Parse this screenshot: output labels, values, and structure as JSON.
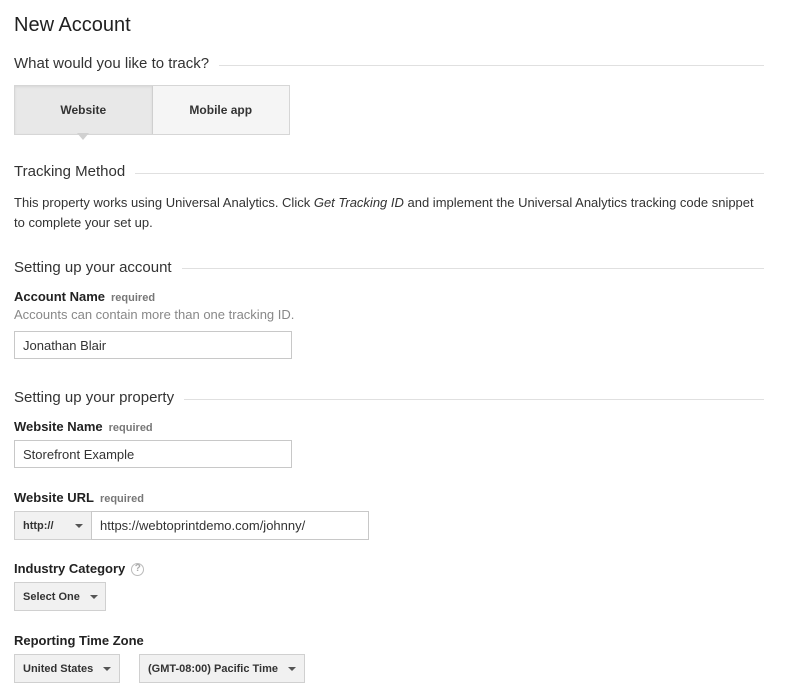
{
  "page": {
    "title": "New Account"
  },
  "track": {
    "heading": "What would you like to track?",
    "options": [
      "Website",
      "Mobile app"
    ],
    "selected": "Website"
  },
  "tracking_method": {
    "heading": "Tracking Method",
    "text_before": "This property works using Universal Analytics. Click ",
    "link_text": "Get Tracking ID",
    "text_after": " and implement the Universal Analytics tracking code snippet to complete your set up."
  },
  "account": {
    "heading": "Setting up your account",
    "name_label": "Account Name",
    "required": "required",
    "hint": "Accounts can contain more than one tracking ID.",
    "name_value": "Jonathan Blair"
  },
  "property": {
    "heading": "Setting up your property",
    "website_name_label": "Website Name",
    "website_name_value": "Storefront Example",
    "website_url_label": "Website URL",
    "protocol": "http://",
    "website_url_value": "https://webtoprintdemo.com/johnny/",
    "industry_label": "Industry Category",
    "help_glyph": "?",
    "industry_value": "Select One",
    "timezone_label": "Reporting Time Zone",
    "country_value": "United States",
    "timezone_value": "(GMT-08:00) Pacific Time"
  }
}
